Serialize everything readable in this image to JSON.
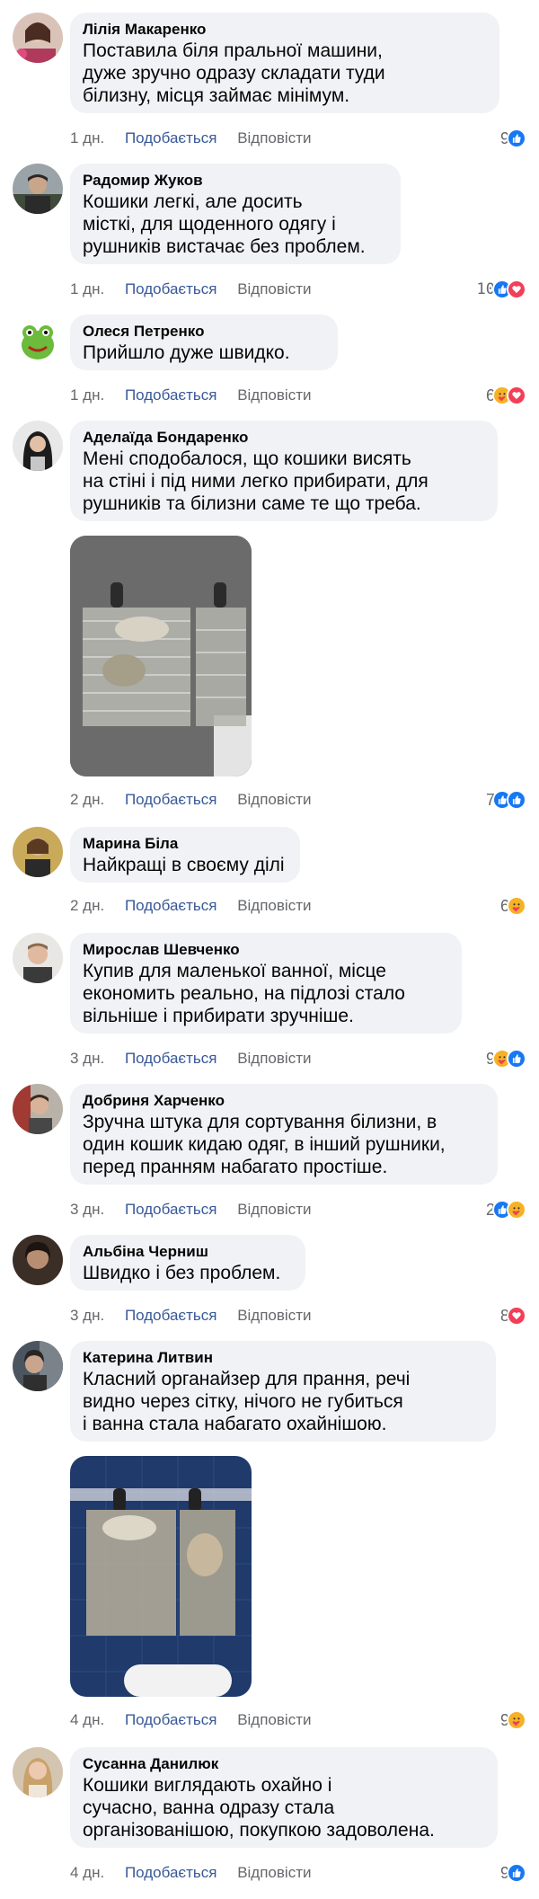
{
  "actions": {
    "like_label": "Подобається",
    "reply_label": "Відповісти"
  },
  "colors": {
    "bubble": "#f0f2f5",
    "link": "#385898",
    "muted": "#65676b",
    "like_blue": "#1877f2",
    "love_red": "#f33e58",
    "care_yellow": "#f7b125"
  },
  "comments": [
    {
      "author": "Лілія Макаренко",
      "text": "Поставила біля пральної машини,\nдуже зручно одразу складати туди\nбілизну, місця займає мінімум.",
      "time": "1 дн.",
      "count": "9",
      "reactions": [
        "like-icon"
      ]
    },
    {
      "author": "Радомир Жуков",
      "text": "Кошики легкі, але досить\nмісткі, для щоденного одягу і\nрушників вистачає без проблем.",
      "time": "1 дн.",
      "count": "10",
      "reactions": [
        "like-icon",
        "love-icon"
      ]
    },
    {
      "author": "Олеся Петренко",
      "text": "Прийшло дуже швидко.",
      "time": "1 дн.",
      "count": "6",
      "reactions": [
        "care-icon",
        "love-icon"
      ]
    },
    {
      "author": "Аделаїда Бондаренко",
      "text": "Мені сподобалося, що кошики висять\nна стіні і під ними легко прибирати, для\nрушників та білизни саме те що треба.",
      "time": "2 дн.",
      "count": "7",
      "reactions": [
        "like-icon",
        "like-icon"
      ]
    },
    {
      "author": "Марина Біла",
      "text": "Найкращі в своєму ділі",
      "time": "2 дн.",
      "count": "6",
      "reactions": [
        "care-icon"
      ]
    },
    {
      "author": "Мирослав Шевченко",
      "text": "Купив для маленької ванної, місце\nекономить реально, на підлозі стало\nвільніше і прибирати зручніше.",
      "time": "3 дн.",
      "count": "9",
      "reactions": [
        "care-icon",
        "like-icon"
      ]
    },
    {
      "author": "Добриня Харченко",
      "text": "Зручна штука для сортування білизни, в\nодин кошик кидаю одяг, в інший рушники,\nперед пранням набагато простіше.",
      "time": "3 дн.",
      "count": "2",
      "reactions": [
        "like-icon",
        "care-icon"
      ]
    },
    {
      "author": "Альбіна Черниш",
      "text": "Швидко і без проблем.",
      "time": "3 дн.",
      "count": "8",
      "reactions": [
        "love-icon"
      ]
    },
    {
      "author": "Катерина Литвин",
      "text": "Класний органайзер для прання, речі\nвидно через сітку, нічого не губиться\nі ванна стала набагато охайнішою.",
      "time": "4 дн.",
      "count": "9",
      "reactions": [
        "care-icon"
      ]
    },
    {
      "author": "Сусанна Данилюк",
      "text": "Кошики виглядають охайно і\nсучасно, ванна одразу стала\nорганізованішою, покупкою задоволена.",
      "time": "4 дн.",
      "count": "9",
      "reactions": [
        "like-icon"
      ]
    }
  ]
}
